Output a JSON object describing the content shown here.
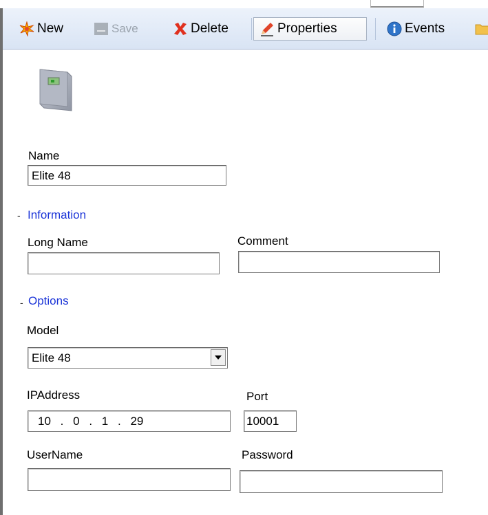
{
  "toolbar": {
    "new_label": "New",
    "save_label": "Save",
    "delete_label": "Delete",
    "properties_label": "Properties",
    "events_label": "Events"
  },
  "device": {
    "icon": "panel-device-icon"
  },
  "name": {
    "label": "Name",
    "value": "Elite 48"
  },
  "information": {
    "title": "Information",
    "long_name_label": "Long Name",
    "long_name_value": "",
    "comment_label": "Comment",
    "comment_value": ""
  },
  "options": {
    "title": "Options",
    "model_label": "Model",
    "model_value": "Elite 48",
    "ip_label": "IPAddress",
    "ip_octets": [
      "10",
      "0",
      "1",
      "29"
    ],
    "port_label": "Port",
    "port_value": "10001",
    "username_label": "UserName",
    "username_value": "",
    "password_label": "Password",
    "password_value": ""
  },
  "colors": {
    "section": "#1c35d8",
    "toolbar": "#dfe8f5",
    "delete_x": "#e0301e"
  }
}
